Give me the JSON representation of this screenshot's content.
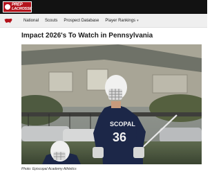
{
  "brand": {
    "logo_line1": "PREP",
    "logo_line2": "LACROSSE"
  },
  "nav": {
    "items": [
      {
        "label": "National"
      },
      {
        "label": "Scouts"
      },
      {
        "label": "Prospect Database"
      },
      {
        "label": "Player Rankings"
      }
    ]
  },
  "article": {
    "title": "Impact 2026's To Watch in Pennsylvania",
    "photo_caption": "Photo: Episcopal Academy Athletics",
    "jersey_text": "SCOPAL",
    "jersey_number": "36"
  },
  "colors": {
    "topbar": "#121212",
    "logo_red": "#b3121b",
    "nav_bg": "#efefef",
    "jersey_navy": "#1c2748"
  }
}
